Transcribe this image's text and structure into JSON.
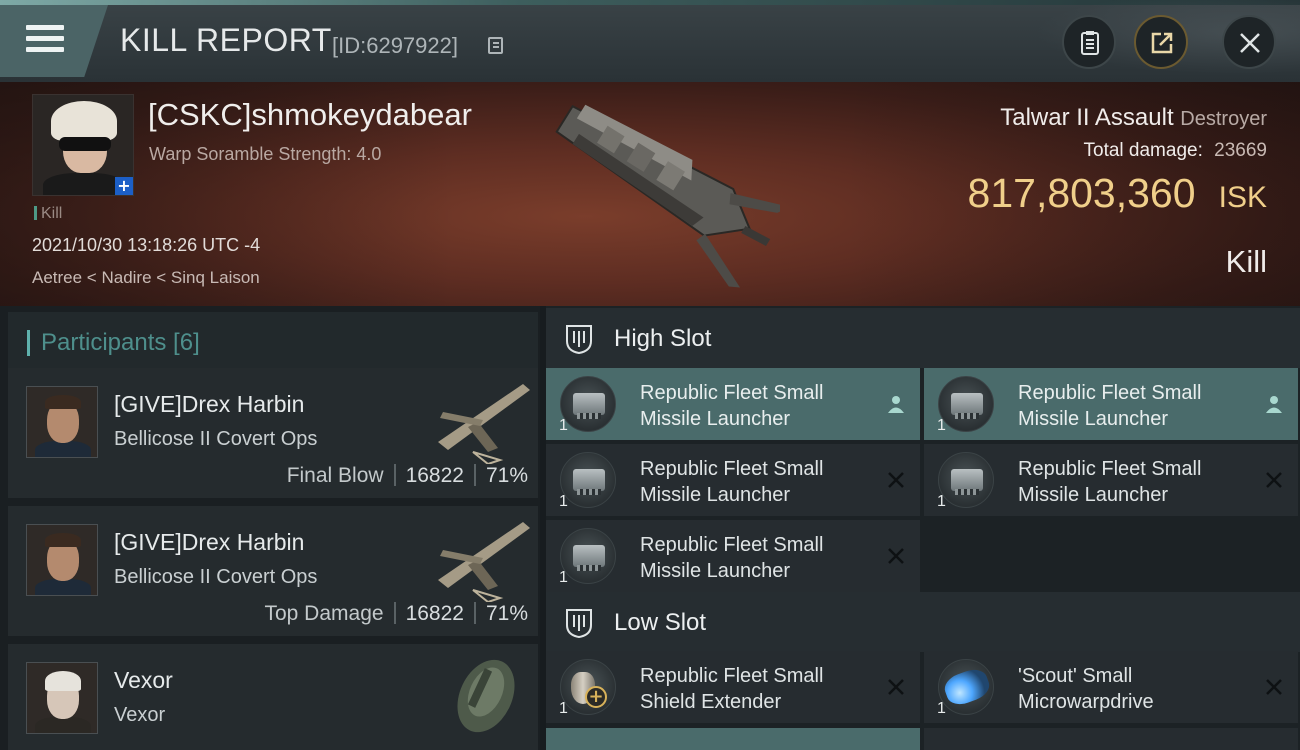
{
  "header": {
    "title": "KILL REPORT",
    "report_id": "[ID:6297922]"
  },
  "victim": {
    "name": "[CSKC]shmokeydabear",
    "warp_scramble": "Warp Soramble Strength: 4.0",
    "kill_tag": "Kill",
    "datetime": "2021/10/30 13:18:26 UTC -4",
    "location": "Aetree < Nadire < Sinq Laison",
    "ship_name": "Talwar II Assault",
    "ship_class": "Destroyer",
    "total_damage_label": "Total damage:",
    "total_damage": "23669",
    "isk_value": "817,803,360",
    "isk_unit": "ISK",
    "result": "Kill"
  },
  "participants": {
    "title": "Participants [6]",
    "items": [
      {
        "name": "[GIVE]Drex Harbin",
        "ship": "Bellicose II Covert Ops",
        "label": "Final Blow",
        "damage": "16822",
        "percent": "71%"
      },
      {
        "name": "[GIVE]Drex Harbin",
        "ship": "Bellicose II Covert Ops",
        "label": "Top Damage",
        "damage": "16822",
        "percent": "71%"
      },
      {
        "name": "Vexor",
        "ship": "Vexor"
      }
    ]
  },
  "fitting": {
    "high_slot_label": "High Slot",
    "low_slot_label": "Low Slot",
    "high_modules": [
      {
        "name1": "Republic Fleet Small",
        "name2": "Missile Launcher",
        "qty": "1",
        "status": "used"
      },
      {
        "name1": "Republic Fleet Small",
        "name2": "Missile Launcher",
        "qty": "1",
        "status": "used"
      },
      {
        "name1": "Republic Fleet Small",
        "name2": "Missile Launcher",
        "qty": "1",
        "status": "destroyed"
      },
      {
        "name1": "Republic Fleet Small",
        "name2": "Missile Launcher",
        "qty": "1",
        "status": "destroyed"
      },
      {
        "name1": "Republic Fleet Small",
        "name2": "Missile Launcher",
        "qty": "1",
        "status": "destroyed"
      }
    ],
    "low_modules": [
      {
        "name1": "Republic Fleet Small",
        "name2": "Shield Extender",
        "qty": "1",
        "status": "destroyed"
      },
      {
        "name1": "'Scout' Small",
        "name2": "Microwarpdrive",
        "qty": "1",
        "status": "destroyed"
      }
    ]
  },
  "colors": {
    "accent": "#5fb1ad",
    "isk": "#f0cf8a",
    "used_row": "#4a6b6b",
    "banner": "#5e2d22"
  }
}
